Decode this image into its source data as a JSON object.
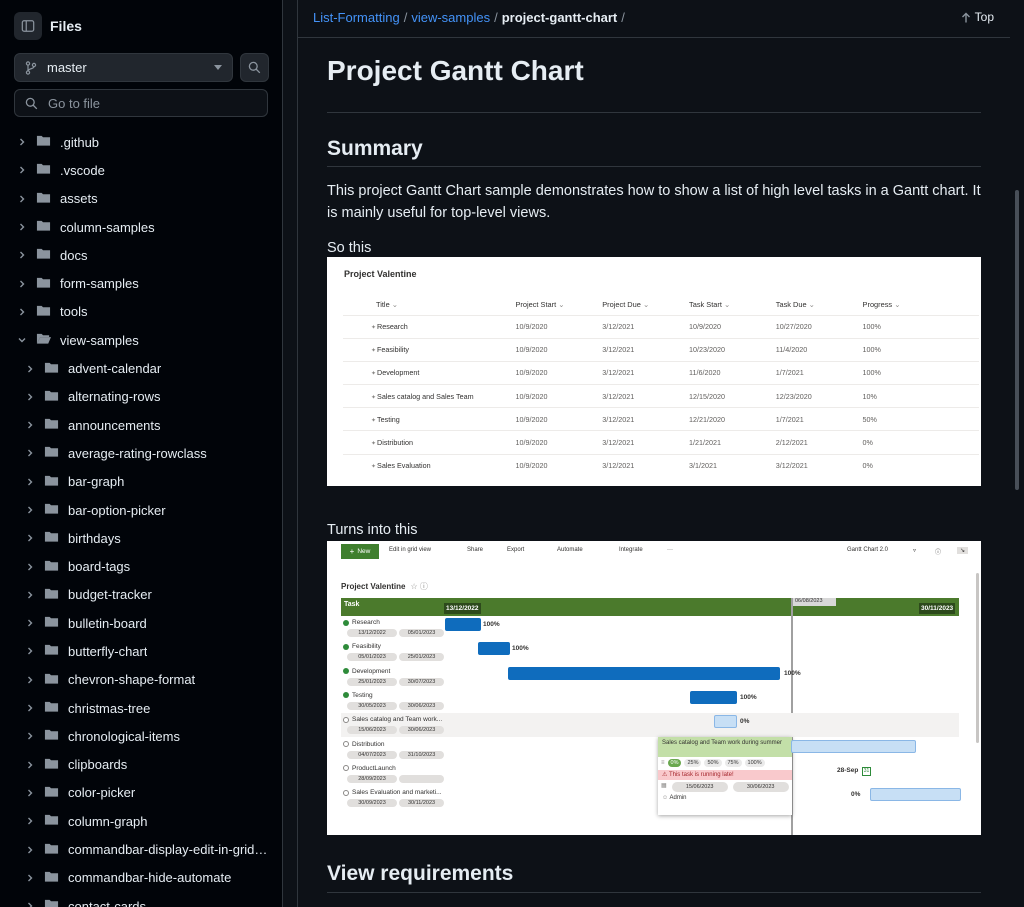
{
  "sidebar": {
    "title": "Files",
    "branch": "master",
    "goto_placeholder": "Go to file",
    "tree": [
      {
        "name": ".github",
        "level": 0,
        "open": false
      },
      {
        "name": ".vscode",
        "level": 0,
        "open": false
      },
      {
        "name": "assets",
        "level": 0,
        "open": false
      },
      {
        "name": "column-samples",
        "level": 0,
        "open": false
      },
      {
        "name": "docs",
        "level": 0,
        "open": false
      },
      {
        "name": "form-samples",
        "level": 0,
        "open": false
      },
      {
        "name": "tools",
        "level": 0,
        "open": false
      },
      {
        "name": "view-samples",
        "level": 0,
        "open": true
      },
      {
        "name": "advent-calendar",
        "level": 1,
        "open": false
      },
      {
        "name": "alternating-rows",
        "level": 1,
        "open": false
      },
      {
        "name": "announcements",
        "level": 1,
        "open": false
      },
      {
        "name": "average-rating-rowclass",
        "level": 1,
        "open": false
      },
      {
        "name": "bar-graph",
        "level": 1,
        "open": false
      },
      {
        "name": "bar-option-picker",
        "level": 1,
        "open": false
      },
      {
        "name": "birthdays",
        "level": 1,
        "open": false
      },
      {
        "name": "board-tags",
        "level": 1,
        "open": false
      },
      {
        "name": "budget-tracker",
        "level": 1,
        "open": false
      },
      {
        "name": "bulletin-board",
        "level": 1,
        "open": false
      },
      {
        "name": "butterfly-chart",
        "level": 1,
        "open": false
      },
      {
        "name": "chevron-shape-format",
        "level": 1,
        "open": false
      },
      {
        "name": "christmas-tree",
        "level": 1,
        "open": false
      },
      {
        "name": "chronological-items",
        "level": 1,
        "open": false
      },
      {
        "name": "clipboards",
        "level": 1,
        "open": false
      },
      {
        "name": "color-picker",
        "level": 1,
        "open": false
      },
      {
        "name": "column-graph",
        "level": 1,
        "open": false
      },
      {
        "name": "commandbar-display-edit-in-gridv...",
        "level": 1,
        "open": false
      },
      {
        "name": "commandbar-hide-automate",
        "level": 1,
        "open": false
      },
      {
        "name": "contact-cards",
        "level": 1,
        "open": false
      }
    ]
  },
  "breadcrumb": {
    "root": "List-Formatting",
    "folder": "view-samples",
    "current": "project-gantt-chart",
    "trailing": "/"
  },
  "top_label": "Top",
  "content": {
    "title": "Project Gantt Chart",
    "summary_heading": "Summary",
    "summary_text": "This project Gantt Chart sample demonstrates how to show a list of high level tasks in a Gantt chart. It is mainly useful for top-level views.",
    "so_this": "So this",
    "turns_into": "Turns into this",
    "view_req_heading": "View requirements"
  },
  "list_image": {
    "title": "Project Valentine",
    "columns": [
      "Title",
      "Project Start",
      "Project Due",
      "Task Start",
      "Task Due",
      "Progress"
    ],
    "rows": [
      [
        "Research",
        "10/9/2020",
        "3/12/2021",
        "10/9/2020",
        "10/27/2020",
        "100%"
      ],
      [
        "Feasibility",
        "10/9/2020",
        "3/12/2021",
        "10/23/2020",
        "11/4/2020",
        "100%"
      ],
      [
        "Development",
        "10/9/2020",
        "3/12/2021",
        "11/6/2020",
        "1/7/2021",
        "100%"
      ],
      [
        "Sales catalog and Sales Team",
        "10/9/2020",
        "3/12/2021",
        "12/15/2020",
        "12/23/2020",
        "10%"
      ],
      [
        "Testing",
        "10/9/2020",
        "3/12/2021",
        "12/21/2020",
        "1/7/2021",
        "50%"
      ],
      [
        "Distribution",
        "10/9/2020",
        "3/12/2021",
        "1/21/2021",
        "2/12/2021",
        "0%"
      ],
      [
        "Sales Evaluation",
        "10/9/2020",
        "3/12/2021",
        "3/1/2021",
        "3/12/2021",
        "0%"
      ]
    ]
  },
  "gantt_image": {
    "commands": {
      "new": "New",
      "edit_grid": "Edit in grid view",
      "share": "Share",
      "export": "Export",
      "automate": "Automate",
      "integrate": "Integrate",
      "more": "···",
      "view": "Gantt Chart 2.0"
    },
    "title": "Project Valentine",
    "task_header": "Task",
    "start_date": "13/12/2022",
    "today": "06/08/2023",
    "end_date": "30/11/2023",
    "tasks": [
      {
        "name": "Research",
        "start": "13/12/2022",
        "end": "05/01/2023",
        "pct": "100%",
        "done": true
      },
      {
        "name": "Feasibility",
        "start": "05/01/2023",
        "end": "25/01/2023",
        "pct": "100%",
        "done": true
      },
      {
        "name": "Development",
        "start": "25/01/2023",
        "end": "30/07/2023",
        "pct": "100%",
        "done": true
      },
      {
        "name": "Testing",
        "start": "30/05/2023",
        "end": "30/06/2023",
        "pct": "100%",
        "done": true
      },
      {
        "name": "Sales catalog and Team work...",
        "start": "15/06/2023",
        "end": "30/06/2023",
        "pct": "0%",
        "done": false
      },
      {
        "name": "Distribution",
        "start": "04/07/2023",
        "end": "31/10/2023",
        "pct": "",
        "done": false
      },
      {
        "name": "ProductLaunch",
        "start": "28/09/2023",
        "end": "",
        "pct": "",
        "done": false
      },
      {
        "name": "Sales Evaluation and marketi...",
        "start": "30/09/2023",
        "end": "30/11/2023",
        "pct": "0%",
        "done": false
      }
    ],
    "milestone_label": "28-Sep",
    "tooltip": {
      "title": "Sales catalog and Team work during summer",
      "progress_options": [
        "0%",
        "25%",
        "50%",
        "75%",
        "100%"
      ],
      "selected": "0%",
      "late_msg": "This task is running late!",
      "start": "15/06/2023",
      "end": "30/06/2023",
      "owner": "Admin"
    }
  }
}
